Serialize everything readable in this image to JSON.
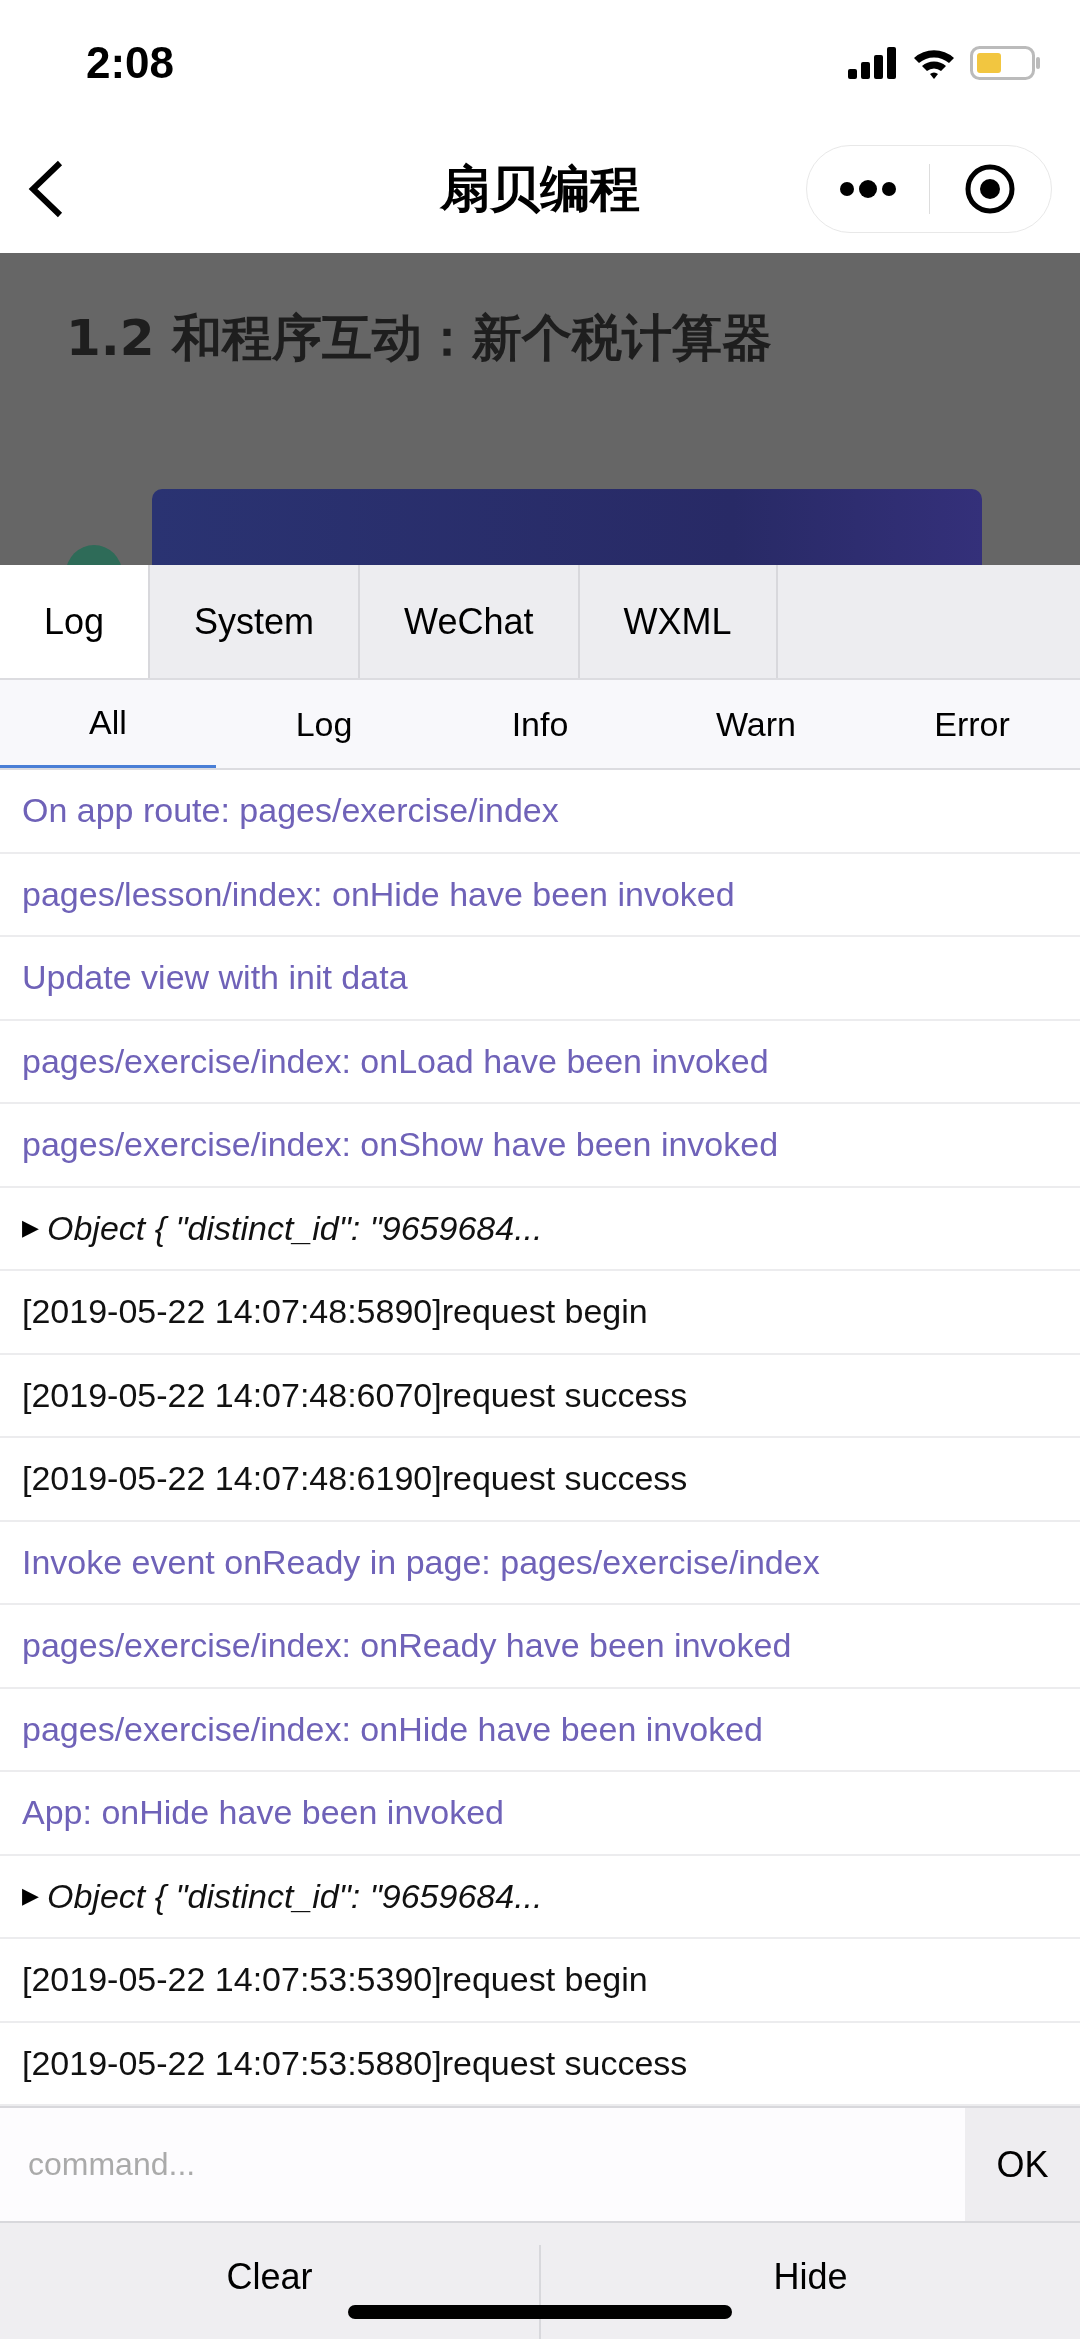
{
  "status_bar": {
    "time": "2:08"
  },
  "nav": {
    "title": "扇贝编程"
  },
  "page": {
    "heading": "1.2 和程序互动：新个税计算器"
  },
  "tabs": [
    {
      "label": "Log",
      "selected": true
    },
    {
      "label": "System",
      "selected": false
    },
    {
      "label": "WeChat",
      "selected": false
    },
    {
      "label": "WXML",
      "selected": false
    }
  ],
  "filters": [
    {
      "label": "All",
      "selected": true
    },
    {
      "label": "Log",
      "selected": false
    },
    {
      "label": "Info",
      "selected": false
    },
    {
      "label": "Warn",
      "selected": false
    },
    {
      "label": "Error",
      "selected": false
    }
  ],
  "logs": [
    {
      "kind": "info",
      "text": "On app route: pages/exercise/index"
    },
    {
      "kind": "info",
      "text": "pages/lesson/index: onHide have been invoked"
    },
    {
      "kind": "info",
      "text": "Update view with init data"
    },
    {
      "kind": "info",
      "text": "pages/exercise/index: onLoad have been invoked"
    },
    {
      "kind": "info",
      "text": "pages/exercise/index: onShow have been invoked"
    },
    {
      "kind": "object",
      "toggle": "▶",
      "text": "Object { \"distinct_id\": \"9659684..."
    },
    {
      "kind": "log",
      "text": "[2019-05-22 14:07:48:5890]request begin"
    },
    {
      "kind": "log",
      "text": "[2019-05-22 14:07:48:6070]request success"
    },
    {
      "kind": "log",
      "text": "[2019-05-22 14:07:48:6190]request success"
    },
    {
      "kind": "info",
      "text": "Invoke event onReady in page: pages/exercise/index"
    },
    {
      "kind": "info",
      "text": "pages/exercise/index: onReady have been invoked"
    },
    {
      "kind": "info",
      "text": "pages/exercise/index: onHide have been invoked"
    },
    {
      "kind": "info",
      "text": "App: onHide have been invoked"
    },
    {
      "kind": "object",
      "toggle": "▶",
      "text": "Object { \"distinct_id\": \"9659684..."
    },
    {
      "kind": "log",
      "text": "[2019-05-22 14:07:53:5390]request begin"
    },
    {
      "kind": "log",
      "text": "[2019-05-22 14:07:53:5880]request success"
    }
  ],
  "command": {
    "placeholder": "command...",
    "button": "OK"
  },
  "actions": [
    "Clear",
    "Hide"
  ]
}
